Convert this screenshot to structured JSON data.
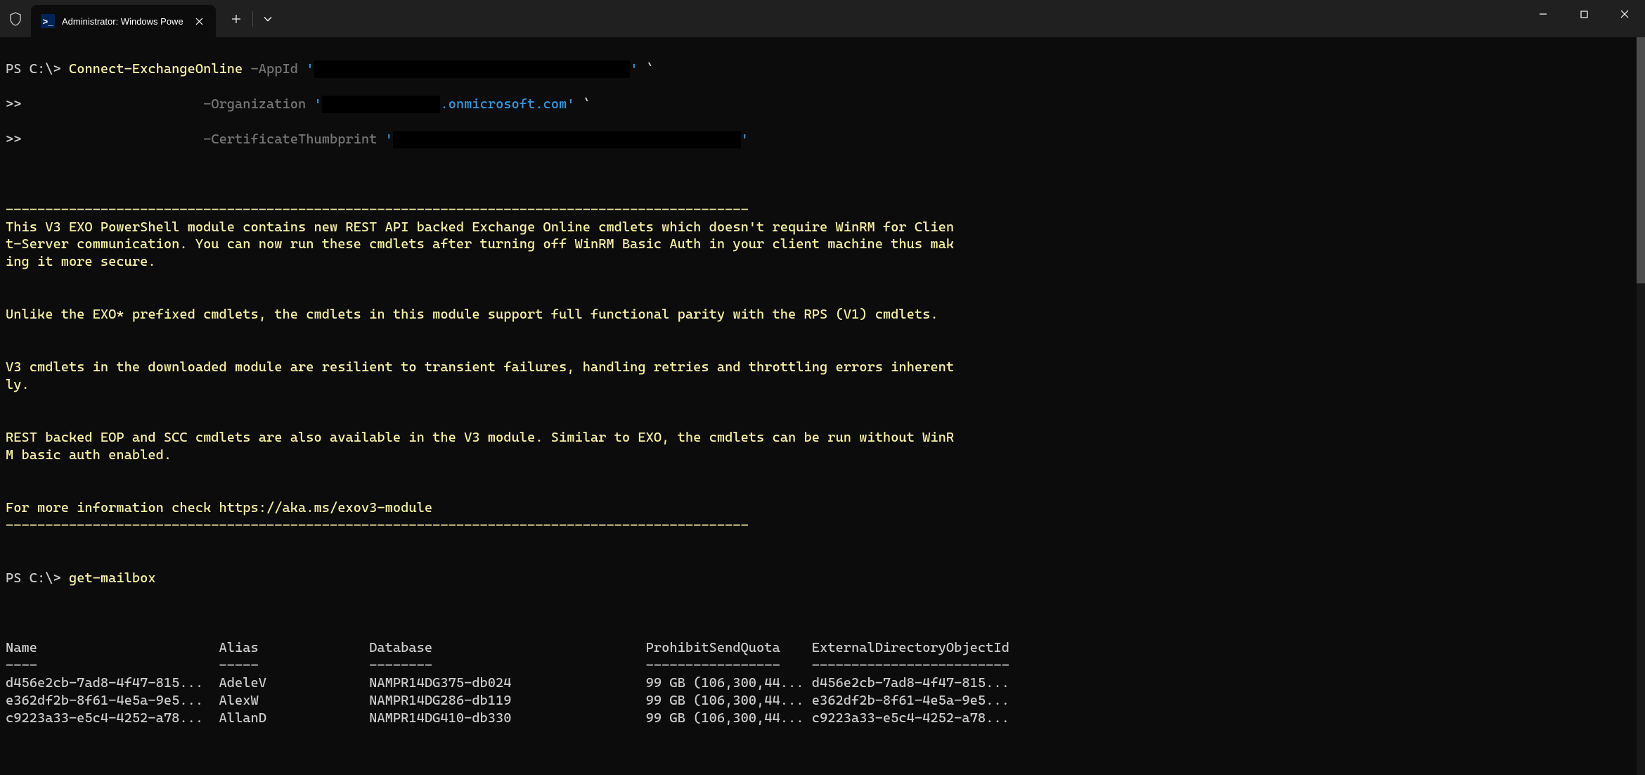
{
  "titlebar": {
    "tab_title": "Administrator: Windows Powe",
    "tab_icon_text": ">_"
  },
  "terminal": {
    "line1_prompt": "PS C:\\> ",
    "line1_cmd": "Connect-ExchangeOnline",
    "line1_param1": " -AppId ",
    "line1_val1a": "'",
    "line1_val1b": "'",
    "line1_tick": " `",
    "line2_prompt": ">>                       ",
    "line2_param": "-Organization ",
    "line2_val_a": "'",
    "line2_val_suffix": ".onmicrosoft.com'",
    "line2_tick": " `",
    "line3_prompt": ">>                       ",
    "line3_param": "-CertificateThumbprint ",
    "line3_val_a": "'",
    "line3_val_b": "'",
    "divider": "----------------------------------------------------------------------------------------------",
    "para1": "This V3 EXO PowerShell module contains new REST API backed Exchange Online cmdlets which doesn't require WinRM for Clien\nt-Server communication. You can now run these cmdlets after turning off WinRM Basic Auth in your client machine thus mak\ning it more secure.",
    "para2": "Unlike the EXO* prefixed cmdlets, the cmdlets in this module support full functional parity with the RPS (V1) cmdlets.",
    "para3": "V3 cmdlets in the downloaded module are resilient to transient failures, handling retries and throttling errors inherent\nly.",
    "para4": "REST backed EOP and SCC cmdlets are also available in the V3 module. Similar to EXO, the cmdlets can be run without WinR\nM basic auth enabled.",
    "para5": "For more information check https://aka.ms/exov3-module",
    "divider2": "----------------------------------------------------------------------------------------------",
    "prompt2": "PS C:\\> ",
    "cmd2": "get-mailbox",
    "table": {
      "header": "Name                       Alias              Database                           ProhibitSendQuota    ExternalDirectoryObjectId",
      "underline": "----                       -----              --------                           -----------------    -------------------------",
      "row1": "d456e2cb-7ad8-4f47-815...  AdeleV             NAMPR14DG375-db024                 99 GB (106,300,44... d456e2cb-7ad8-4f47-815...",
      "row2": "e362df2b-8f61-4e5a-9e5...  AlexW              NAMPR14DG286-db119                 99 GB (106,300,44... e362df2b-8f61-4e5a-9e5...",
      "row3": "c9223a33-e5c4-4252-a78...  AllanD             NAMPR14DG410-db330                 99 GB (106,300,44... c9223a33-e5c4-4252-a78..."
    }
  }
}
